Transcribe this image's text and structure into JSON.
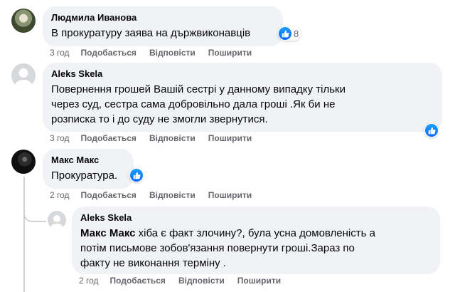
{
  "comments": [
    {
      "author": "Людмила Иванова",
      "text": "В прокуратуру заява на държвиконавців",
      "reactions": "8",
      "time": "3 год",
      "like": "Подобається",
      "reply": "Відповісти",
      "share": "Поширити"
    },
    {
      "author": "Aleks Skela",
      "text_lines": [
        "Повернення грошей Вашій сестрі у данному випадку тільки",
        "через суд, сестра сама добровільно дала гроші .Як би не",
        "розписка то і до суду не змогли звернутися."
      ],
      "time": "3 год",
      "like": "Подобається",
      "reply": "Відповісти",
      "share": "Поширити"
    },
    {
      "author": "Макс Макс",
      "text": "Прокуратура.",
      "time": "2 год",
      "like": "Подобається",
      "reply": "Відповісти",
      "share": "Поширити"
    },
    {
      "author": "Aleks Skela",
      "mention": "Макс Макс",
      "text_first": " хіба є факт злочину?, була усна домовленість а",
      "text_lines": [
        "потім письмове зобов'язання повернути гроші.Зараз по",
        "факту не виконання терміну ."
      ],
      "time": "2 год",
      "like": "Подобається",
      "reply": "Відповісти",
      "share": "Поширити"
    }
  ],
  "colors": {
    "bubble": "#f0f2f5",
    "meta_text": "#65676b",
    "like_blue": "#0866ff"
  },
  "icons": {
    "like": "thumbs-up-icon"
  }
}
